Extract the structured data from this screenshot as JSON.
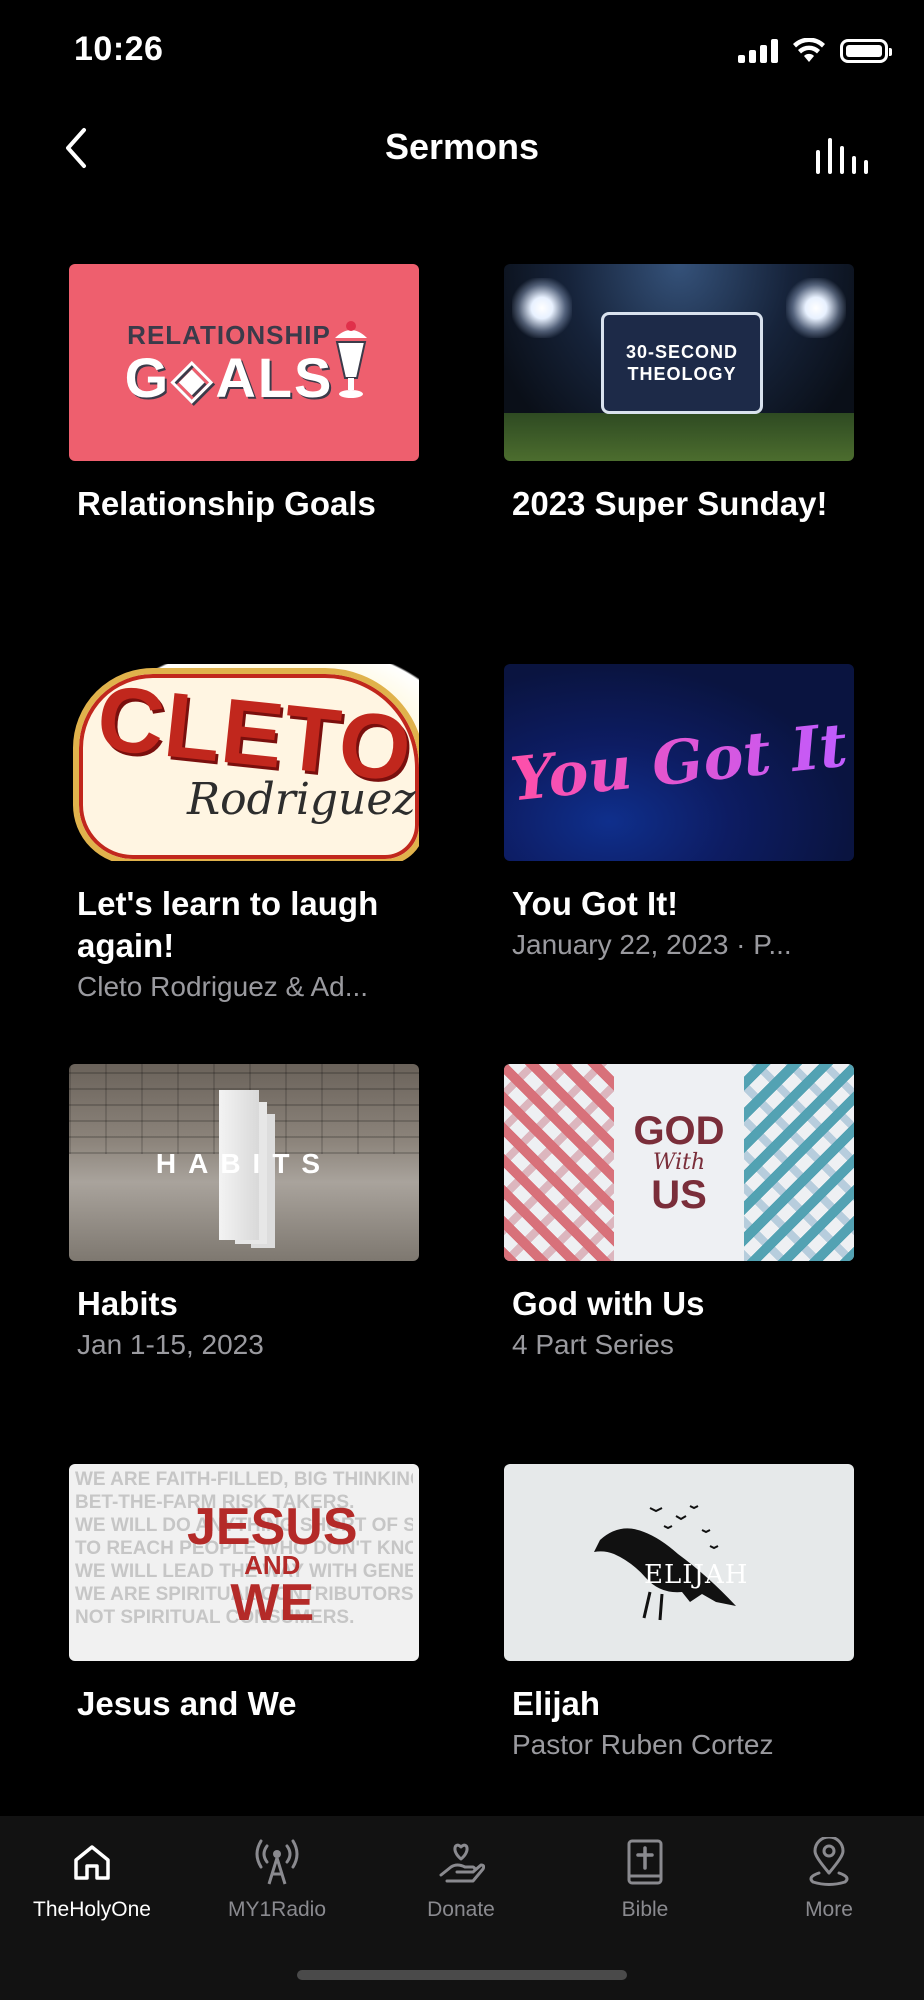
{
  "status_bar": {
    "time": "10:26"
  },
  "nav": {
    "title": "Sermons"
  },
  "sermons": [
    {
      "title": "Relationship Goals",
      "subtitle": "",
      "art_text": [
        "RELATIONSHIP",
        "G",
        "ALS"
      ]
    },
    {
      "title": "2023 Super Sunday!",
      "subtitle": "",
      "art_text": [
        "30-SECOND",
        "THEOLOGY"
      ]
    },
    {
      "title": "Let's learn to laugh again!",
      "subtitle": "Cleto Rodriguez & Ad...",
      "art_text": [
        "CLETO",
        "Rodriguez"
      ]
    },
    {
      "title": "You Got It!",
      "subtitle": "January 22, 2023 · P...",
      "art_text": [
        "You Got It"
      ]
    },
    {
      "title": "Habits",
      "subtitle": "Jan 1-15, 2023",
      "art_text": [
        "HABITS"
      ]
    },
    {
      "title": "God with Us",
      "subtitle": "4 Part Series",
      "art_text": [
        "GOD",
        "With",
        "US"
      ]
    },
    {
      "title": "Jesus and We",
      "subtitle": "",
      "art_text": [
        "JESUS",
        "AND",
        "WE",
        "WE ARE FAITH-FILLED, BIG THINKING,",
        "BET-THE-FARM RISK TAKERS.",
        "WE WILL DO ANYTHING SHORT OF SIN",
        "TO REACH PEOPLE WHO DON'T KNOW CHRIST.",
        "WE WILL LEAD THE WAY WITH GENEROSITY.",
        "WE ARE SPIRITUAL CONTRIBUTORS",
        "NOT SPIRITUAL CONSUMERS."
      ]
    },
    {
      "title": "Elijah",
      "subtitle": "Pastor Ruben Cortez",
      "art_text": [
        "ELIJAH"
      ]
    }
  ],
  "tabs": [
    {
      "label": "TheHolyOne",
      "icon": "home-icon",
      "active": true
    },
    {
      "label": "MY1Radio",
      "icon": "radio-tower-icon",
      "active": false
    },
    {
      "label": "Donate",
      "icon": "donate-hand-heart-icon",
      "active": false
    },
    {
      "label": "Bible",
      "icon": "bible-book-icon",
      "active": false
    },
    {
      "label": "More",
      "icon": "map-pin-icon",
      "active": false
    }
  ],
  "colors": {
    "background": "#000000",
    "tab_bar": "#121212",
    "subtitle": "#9a9a9f",
    "inactive_tab": "#8a8a8f"
  }
}
